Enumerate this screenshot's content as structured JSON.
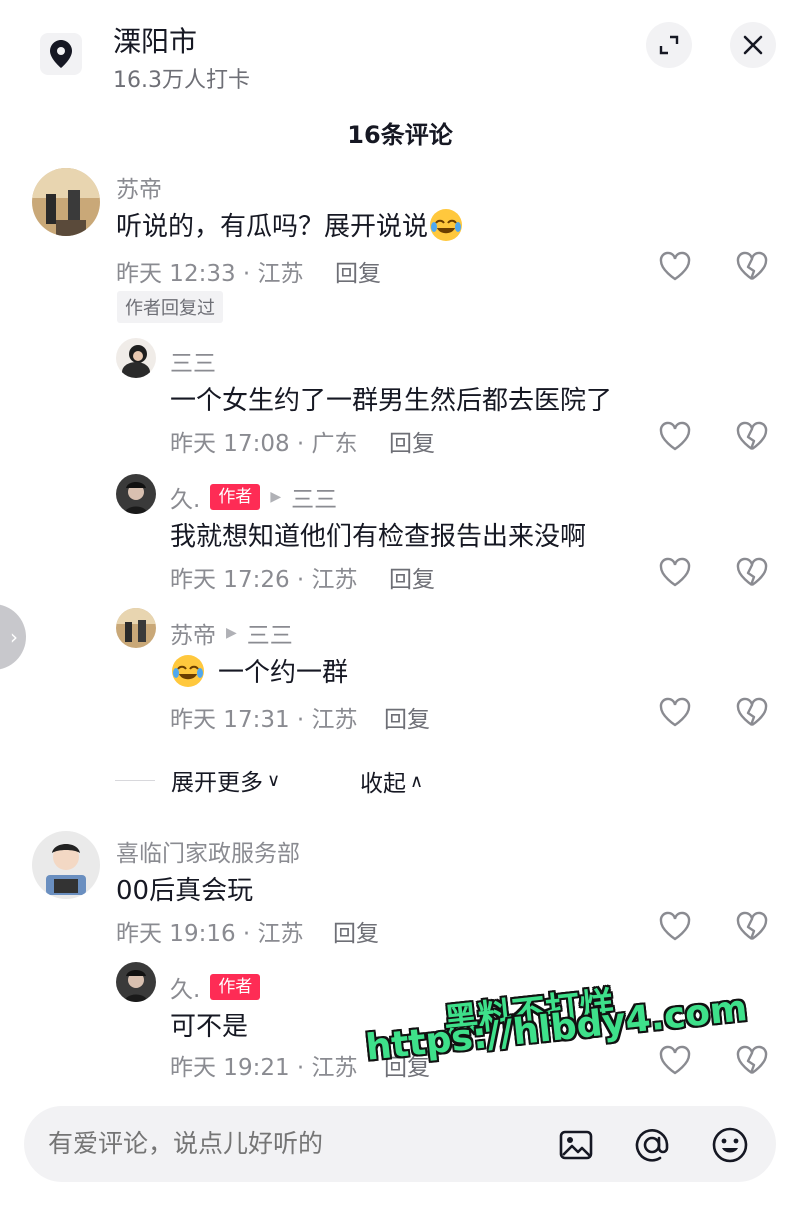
{
  "header": {
    "location_name": "溧阳市",
    "checkin_count": "16.3万人打卡"
  },
  "comments_title": "16条评论",
  "comments": [
    {
      "name": "苏帝",
      "text": "听说的，有瓜吗？展开说说",
      "meta": "昨天 12:33 · 江苏",
      "reply_label": "回复",
      "author_replied_label": "作者回复过",
      "replies": [
        {
          "name": "三三",
          "text": "一个女生约了一群男生然后都去医院了",
          "meta": "昨天 17:08 · 广东",
          "reply_label": "回复"
        },
        {
          "name": "久.",
          "author_tag": "作者",
          "reply_to": "三三",
          "text": "我就想知道他们有检查报告出来没啊",
          "meta": "昨天 17:26 · 江苏",
          "reply_label": "回复"
        },
        {
          "name": "苏帝",
          "reply_to": "三三",
          "text": "一个约一群",
          "meta": "昨天 17:31 · 江苏",
          "reply_label": "回复"
        }
      ],
      "expand_more_label": "展开更多",
      "collapse_label": "收起"
    },
    {
      "name": "喜临门家政服务部",
      "text": "00后真会玩",
      "meta": "昨天 19:16 · 江苏",
      "reply_label": "回复",
      "replies": [
        {
          "name": "久.",
          "author_tag": "作者",
          "text": "可不是",
          "meta": "昨天 19:21 · 江苏",
          "reply_label": "回复"
        }
      ]
    }
  ],
  "input_bar": {
    "placeholder": "有爱评论，说点儿好听的",
    "icons": [
      "image-icon",
      "at-icon",
      "emoji-icon"
    ]
  },
  "watermark": {
    "line1": "黑料不打烊",
    "line2": "https://hlbdy4.com"
  },
  "colors": {
    "author_tag": "#fe2c55",
    "meta_text": "#8a8b91",
    "body_text": "#161823",
    "watermark": "#3ee08a"
  }
}
